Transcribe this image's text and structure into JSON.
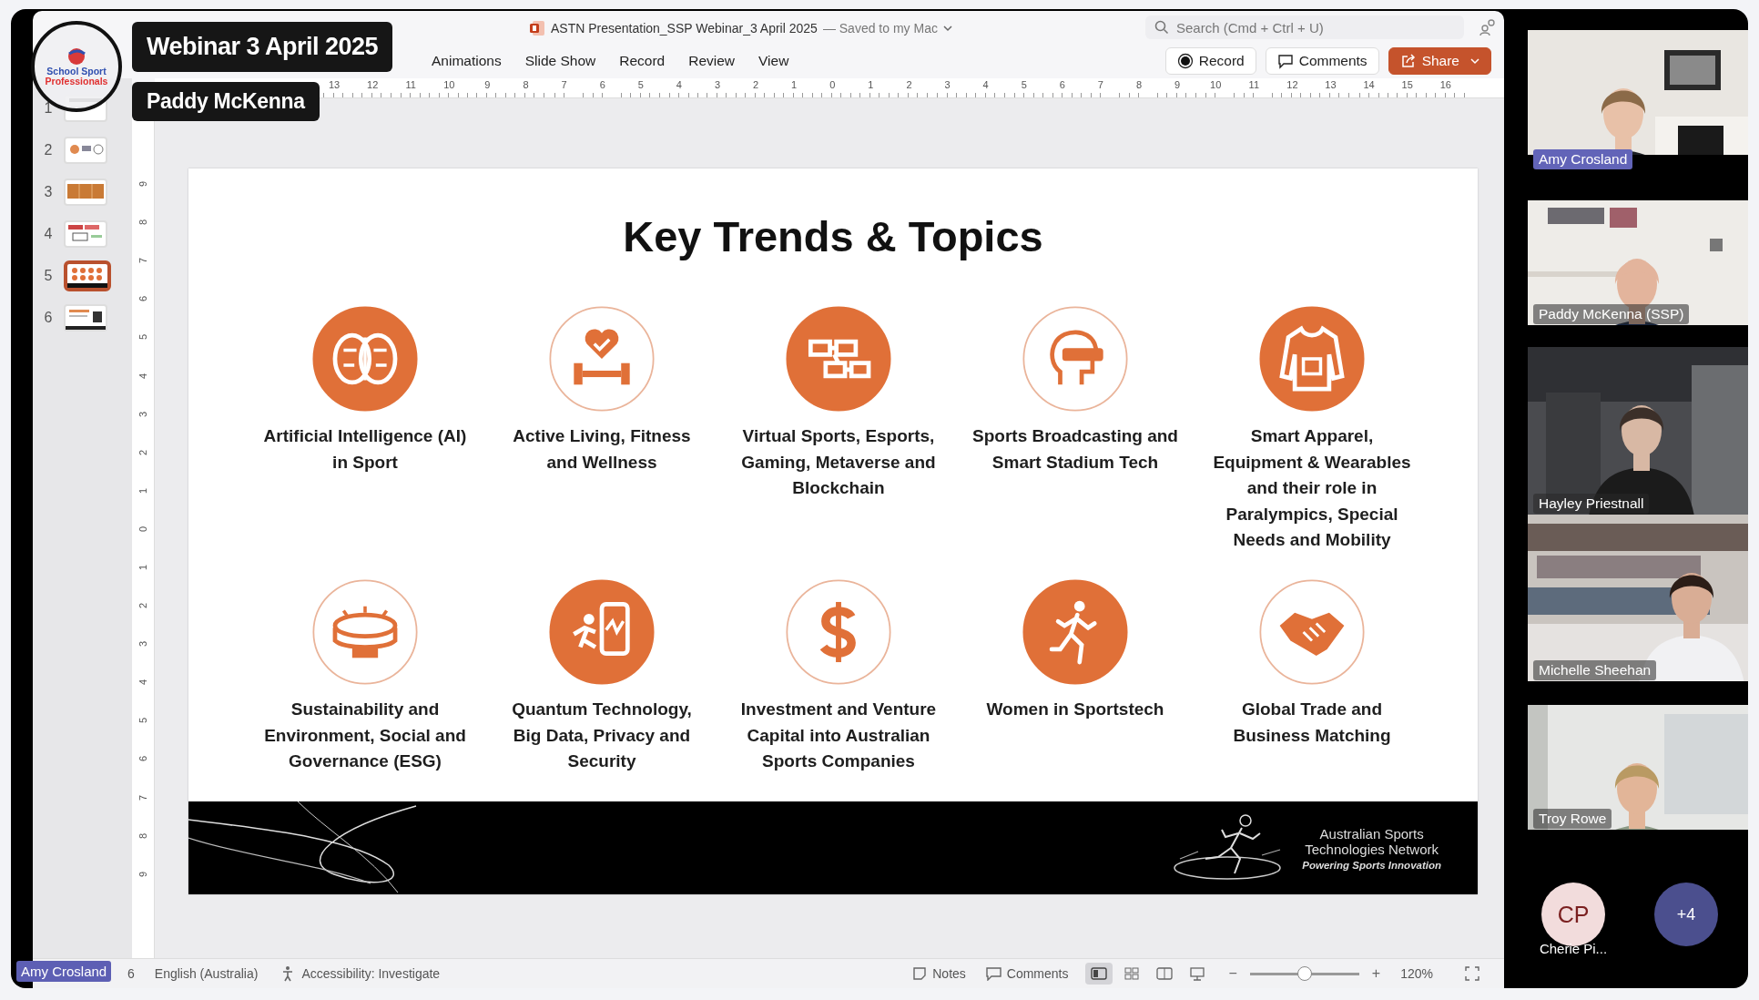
{
  "overlay": {
    "title_badge": "Webinar 3 April 2025",
    "speaker_badge": "Paddy McKenna",
    "logo": {
      "line1": "School Sport",
      "line2": "Professionals"
    },
    "presenter_label": "Amy Crosland"
  },
  "window": {
    "title": "ASTN Presentation_SSP Webinar_3 April 2025",
    "save_state": "— Saved to my Mac",
    "search": {
      "placeholder": "Search (Cmd + Ctrl + U)"
    }
  },
  "ribbon": {
    "tabs": [
      {
        "label": "Animations",
        "selected": false
      },
      {
        "label": "Slide Show",
        "selected": false
      },
      {
        "label": "Record",
        "selected": false
      },
      {
        "label": "Review",
        "selected": false
      },
      {
        "label": "View",
        "selected": false
      }
    ],
    "buttons": [
      {
        "kind": "record",
        "label": "Record"
      },
      {
        "kind": "comments",
        "label": "Comments"
      },
      {
        "kind": "share",
        "label": "Share"
      }
    ]
  },
  "rulers": {
    "horizontal": [
      "13",
      "12",
      "11",
      "10",
      "9",
      "8",
      "7",
      "6",
      "5",
      "4",
      "3",
      "2",
      "1",
      "0",
      "1",
      "2",
      "3",
      "4",
      "5",
      "6",
      "7",
      "8",
      "9",
      "10",
      "11",
      "12",
      "13",
      "14",
      "15",
      "16"
    ],
    "vertical": [
      "9",
      "8",
      "7",
      "6",
      "5",
      "4",
      "3",
      "2",
      "1",
      "0",
      "1",
      "2",
      "3",
      "4",
      "5",
      "6",
      "7",
      "8",
      "9"
    ]
  },
  "thumbnails": [
    {
      "number": "1",
      "selected": false
    },
    {
      "number": "2",
      "selected": false
    },
    {
      "number": "3",
      "selected": false
    },
    {
      "number": "4",
      "selected": false
    },
    {
      "number": "5",
      "selected": true
    },
    {
      "number": "6",
      "selected": false
    }
  ],
  "slide": {
    "title": "Key Trends & Topics",
    "topics": [
      {
        "label": "Artificial Intelligence (AI) in Sport",
        "filled": true
      },
      {
        "label": "Active Living, Fitness and Wellness",
        "filled": false
      },
      {
        "label": "Virtual Sports, Esports, Gaming, Metaverse and Blockchain",
        "filled": true
      },
      {
        "label": "Sports Broadcasting and Smart Stadium Tech",
        "filled": false
      },
      {
        "label": "Smart Apparel, Equipment & Wearables and their role in Paralympics, Special Needs and Mobility",
        "filled": true
      },
      {
        "label": "Sustainability and Environment, Social and Governance (ESG)",
        "filled": false
      },
      {
        "label": "Quantum Technology, Big Data, Privacy and Security",
        "filled": true
      },
      {
        "label": "Investment and Venture Capital into Australian Sports Companies",
        "filled": false
      },
      {
        "label": "Women in Sportstech",
        "filled": true
      },
      {
        "label": "Global Trade and Business Matching",
        "filled": false
      }
    ],
    "footer": {
      "line1": "Australian Sports",
      "line2": "Technologies Network",
      "tagline": "Powering Sports Innovation"
    }
  },
  "status_bar": {
    "slide_count": "6",
    "language": "English (Australia)",
    "accessibility": "Accessibility: Investigate",
    "notes": "Notes",
    "comments": "Comments",
    "view_buttons": [
      {
        "selected": true
      },
      {
        "selected": false
      },
      {
        "selected": false
      },
      {
        "selected": false
      }
    ],
    "zoom": {
      "minus": "−",
      "plus": "+",
      "level": 0.5,
      "reading": "120%"
    }
  },
  "participants": [
    {
      "name": "Amy Crosland",
      "highlighted": true
    },
    {
      "name": "Paddy McKenna (SSP)",
      "highlighted": false
    },
    {
      "name": "Hayley Priestnall",
      "highlighted": false
    },
    {
      "name": "Michelle Sheehan",
      "highlighted": false
    },
    {
      "name": "Troy Rowe",
      "highlighted": false
    }
  ],
  "avatars": [
    {
      "kind": "initials",
      "initials": "CP",
      "name": "Cherie Pi..."
    },
    {
      "kind": "overflow",
      "initials": "+4"
    }
  ]
}
